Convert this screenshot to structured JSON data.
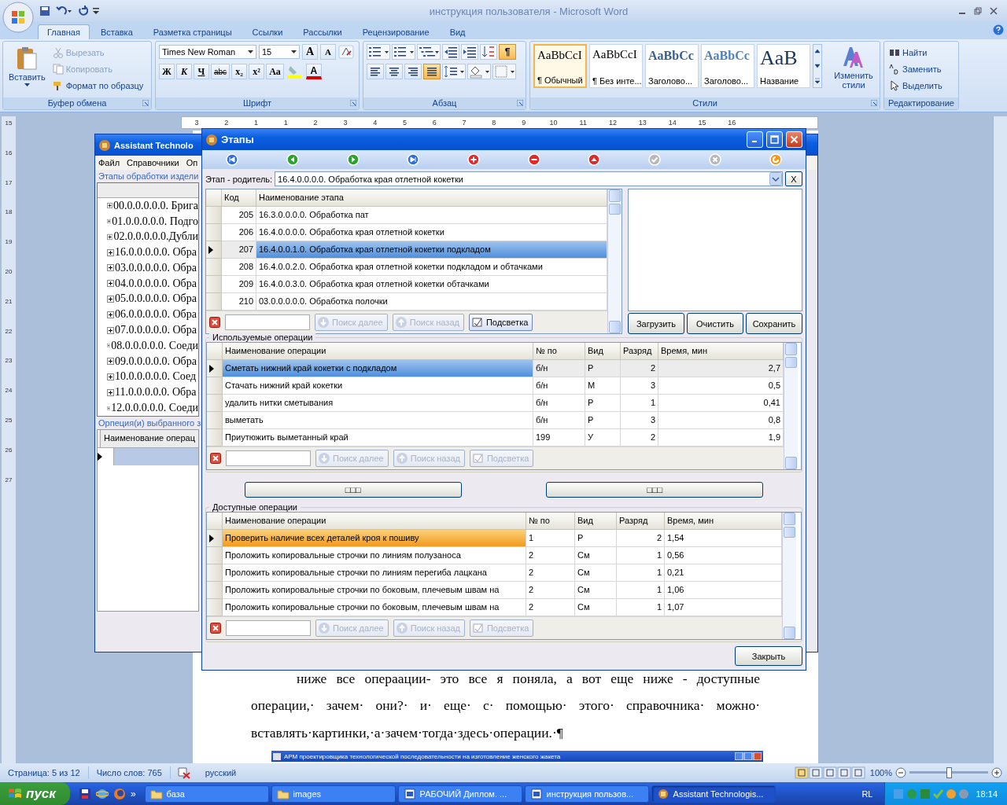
{
  "word": {
    "title": "инструкция пользователя - Microsoft Word",
    "tabs": [
      {
        "label": "Главная",
        "selected": true
      },
      {
        "label": "Вставка",
        "selected": false
      },
      {
        "label": "Разметка страницы",
        "selected": false
      },
      {
        "label": "Ссылки",
        "selected": false
      },
      {
        "label": "Рассылки",
        "selected": false
      },
      {
        "label": "Рецензирование",
        "selected": false
      },
      {
        "label": "Вид",
        "selected": false
      }
    ],
    "clipboard": {
      "paste": "Вставить",
      "items": [
        {
          "label": "Вырезать",
          "disabled": true
        },
        {
          "label": "Копировать",
          "disabled": true
        },
        {
          "label": "Формат по образцу",
          "disabled": false
        }
      ],
      "group": "Буфер обмена"
    },
    "font": {
      "name": "Times New Roman",
      "size": "15",
      "size_buttons": [
        "A",
        "A"
      ],
      "format_buttons": [
        "Ж",
        "К",
        "Ч",
        "abc",
        "x₂",
        "x²",
        "Aa"
      ],
      "color_button": "A",
      "group": "Шрифт"
    },
    "paragraph": {
      "alignment": [
        {
          "kind": "left",
          "selected": false
        },
        {
          "kind": "center",
          "selected": false
        },
        {
          "kind": "right",
          "selected": false
        },
        {
          "kind": "justify",
          "selected": true
        }
      ],
      "marks": {
        "label": "¶",
        "selected": true
      },
      "group": "Абзац"
    },
    "styles": {
      "items": [
        {
          "sample": "AaBbCcI",
          "label": "¶ Обычный",
          "selected": true
        },
        {
          "sample": "AaBbCcI",
          "label": "¶ Без инте...",
          "selected": false
        },
        {
          "sample": "AaBbCc",
          "label": "Заголово...",
          "selected": false
        },
        {
          "sample": "AaBbCc",
          "label": "Заголово...",
          "selected": false
        },
        {
          "sample": "AaB",
          "label": "Название",
          "selected": false
        }
      ],
      "change": "Изменить стили",
      "group": "Стили"
    },
    "editing": {
      "items": [
        "Найти",
        "Заменить",
        "Выделить"
      ],
      "group": "Редактирование"
    },
    "ruler": [
      "3",
      "2",
      "1",
      "1",
      "2",
      "3",
      "4",
      "5",
      "6",
      "7",
      "8",
      "9",
      "10",
      "11",
      "12",
      "13",
      "14",
      "15",
      "16"
    ],
    "vertical_ruler": [
      "15",
      "16",
      "17",
      "18",
      "19",
      "20",
      "21",
      "22",
      "23",
      "24",
      "25",
      "26",
      "27"
    ],
    "document": {
      "lines": [
        "ниже все операации- это все я поняла, а вот еще ниже - доступные",
        "операции,· зачем· они?· и· еще· с· помощью· этого· справочника· можно·",
        "вставлять·картинки,·а·зачем·тогда·здесь·операции.·¶"
      ],
      "embedded_title": "АРМ проектировщика технологической последовательности на изготовление женского жакета"
    },
    "status": {
      "page": "Страница: 5 из 12",
      "words": "Число слов: 765",
      "language": "русский",
      "zoom": "100%",
      "zoom_slider": {
        "level": 0.5
      }
    }
  },
  "assistant": {
    "title": "Assistant Technolo",
    "menu": [
      "Файл",
      "Справочники",
      "Оп"
    ],
    "stages_group": "Этапы обработки издели",
    "tree": [
      {
        "label": "00.0.0.0.0.0. Брига",
        "expanded": false
      },
      {
        "label": "01.0.0.0.0.0. Подго",
        "expanded": false
      },
      {
        "label": "02.0.0.0.0.0.Дубли",
        "expanded": false
      },
      {
        "label": "16.0.0.0.0.0. Обра",
        "expanded": false
      },
      {
        "label": "03.0.0.0.0.0. Обра",
        "expanded": false
      },
      {
        "label": "04.0.0.0.0.0. Обра",
        "expanded": false
      },
      {
        "label": "05.0.0.0.0.0. Обра",
        "expanded": false
      },
      {
        "label": "06.0.0.0.0.0. Обра",
        "expanded": false
      },
      {
        "label": "07.0.0.0.0.0. Обра",
        "expanded": false
      },
      {
        "label": "08.0.0.0.0.0. Соеди",
        "expanded": false
      },
      {
        "label": "09.0.0.0.0.0. Обра",
        "expanded": false
      },
      {
        "label": "10.0.0.0.0.0.  Соед",
        "expanded": false
      },
      {
        "label": "11.0.0.0.0.0. Обра",
        "expanded": false
      },
      {
        "label": "12.0.0.0.0.0. Соеди",
        "expanded": false
      }
    ],
    "ops_group": "Орпеция(и) выбранного з",
    "ops_column": "Наименование операц"
  },
  "stages": {
    "title": "Этапы",
    "parent": {
      "label": "Этап - родитель:",
      "value": "16.4.0.0.0.0. Обработка края отлетной кокетки",
      "clear": "X"
    },
    "table": {
      "columns": [
        "Код",
        "Наименование этапа"
      ],
      "rows": [
        {
          "cells": [
            "205",
            "16.3.0.0.0.0. Обработка пат"
          ],
          "selected": false
        },
        {
          "cells": [
            "206",
            "16.4.0.0.0.0. Обработка края отлетной кокетки"
          ],
          "selected": false
        },
        {
          "cells": [
            "207",
            "16.4.0.0.1.0. Обработка края отлетной кокетки подкладом"
          ],
          "selected": true
        },
        {
          "cells": [
            "208",
            "16.4.0.0.2.0. Обработка края отлетной кокетки подкладом и обтачками"
          ],
          "selected": false
        },
        {
          "cells": [
            "209",
            "16.4.0.0.3.0.  Обработка края отлетной кокетки обтачками"
          ],
          "selected": false
        },
        {
          "cells": [
            "210",
            "03.0.0.0.0.0. Обработка полочки"
          ],
          "selected": false
        }
      ],
      "search": [
        {
          "label": "Поиск далее",
          "disabled": true
        },
        {
          "label": "Поиск назад",
          "disabled": true
        },
        {
          "label": "Подсветка",
          "disabled": false
        }
      ]
    },
    "image_buttons": [
      "Загрузить",
      "Очистить",
      "Сохранить"
    ],
    "used": {
      "group": "Используемые операции",
      "columns": [
        "Наименование операции",
        "№ по",
        "Вид",
        "Разряд",
        "Время, мин"
      ],
      "rows": [
        {
          "cells": [
            "Сметать нижний край кокетки с подкладом",
            "б/н",
            "Р",
            "2",
            "2,7"
          ],
          "selected": true
        },
        {
          "cells": [
            "Стачать нижний край кокетки",
            "б/н",
            "М",
            "3",
            "0,5"
          ],
          "selected": false
        },
        {
          "cells": [
            "удалить нитки сметывания",
            "б/н",
            "Р",
            "1",
            "0,41"
          ],
          "selected": false
        },
        {
          "cells": [
            "выметать",
            "б/н",
            "Р",
            "3",
            "0,8"
          ],
          "selected": false
        },
        {
          "cells": [
            "Приутюжить выметанный край",
            "199",
            "У",
            "2",
            "1,9"
          ],
          "selected": false
        }
      ],
      "search": [
        {
          "label": "Поиск далее",
          "disabled": true
        },
        {
          "label": "Поиск назад",
          "disabled": true
        },
        {
          "label": "Подсветка",
          "disabled": true
        }
      ]
    },
    "move_buttons": [
      "□□□",
      "□□□"
    ],
    "available": {
      "group": "Доступные операции",
      "columns": [
        "Наименование операции",
        "№ по",
        "Вид",
        "Разряд",
        "Время, мин"
      ],
      "rows": [
        {
          "cells": [
            "Проверить наличие всех деталей кроя к пошиву",
            "1",
            "Р",
            "2",
            "1,54"
          ],
          "selected": true
        },
        {
          "cells": [
            "Проложить копировальные строчки по линиям полузаноса",
            "2",
            "См",
            "1",
            "0,56"
          ],
          "selected": false
        },
        {
          "cells": [
            "Проложить копировальные строчки по линиям перегиба лацкана",
            "2",
            "См",
            "1",
            "0,21"
          ],
          "selected": false
        },
        {
          "cells": [
            "Проложить копировальные строчки по боковым, плечевым швам на",
            "2",
            "См",
            "1",
            "1,06"
          ],
          "selected": false
        },
        {
          "cells": [
            "Проложить копировальные строчки по боковым, плечевым швам на",
            "2",
            "См",
            "1",
            "1,07"
          ],
          "selected": false
        }
      ],
      "search": [
        {
          "label": "Поиск далее",
          "disabled": true
        },
        {
          "label": "Поиск назад",
          "disabled": true
        },
        {
          "label": "Подсветка",
          "disabled": true
        }
      ]
    },
    "close": "Закрыть"
  },
  "taskbar": {
    "start": "пуск",
    "more": "»",
    "items": [
      {
        "label": "база",
        "kind": "folder",
        "selected": false
      },
      {
        "label": "images",
        "kind": "folder",
        "selected": false
      },
      {
        "label": "РАБОЧИЙ  Диплом. ...",
        "kind": "document",
        "selected": false
      },
      {
        "label": "инструкция пользов...",
        "kind": "document",
        "selected": false
      },
      {
        "label": "Assistant Technologis...",
        "kind": "app",
        "selected": true
      }
    ],
    "language": "RL",
    "time": "18:14"
  }
}
